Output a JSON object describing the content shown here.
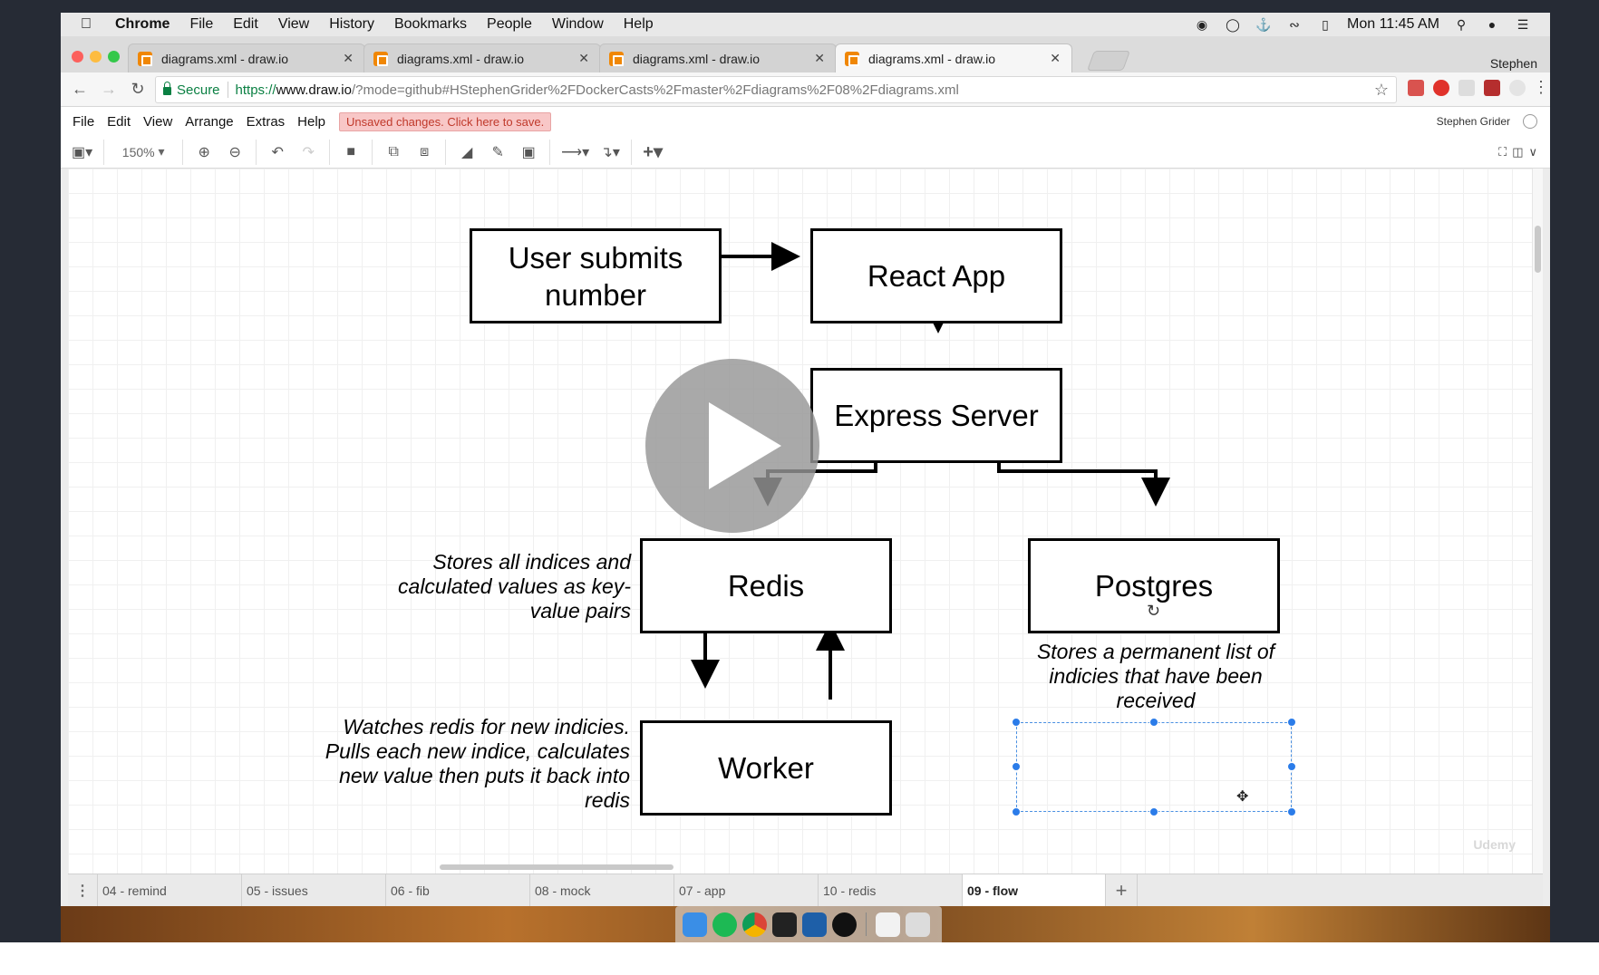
{
  "menubar": {
    "app": "Chrome",
    "items": [
      "File",
      "Edit",
      "View",
      "History",
      "Bookmarks",
      "People",
      "Window",
      "Help"
    ],
    "clock": "Mon 11:45 AM"
  },
  "tabs": [
    {
      "title": "diagrams.xml - draw.io"
    },
    {
      "title": "diagrams.xml - draw.io"
    },
    {
      "title": "diagrams.xml - draw.io"
    },
    {
      "title": "diagrams.xml - draw.io"
    }
  ],
  "profile_name": "Stephen",
  "address": {
    "secure_label": "Secure",
    "url_scheme": "https://",
    "url_host": "www.draw.io",
    "url_rest": "/?mode=github#HStephenGrider%2FDockerCasts%2Fmaster%2Fdiagrams%2F08%2Fdiagrams.xml"
  },
  "drawio_menu": {
    "items": [
      "File",
      "Edit",
      "View",
      "Arrange",
      "Extras",
      "Help"
    ],
    "unsaved": "Unsaved changes. Click here to save.",
    "user": "Stephen Grider"
  },
  "toolbar": {
    "zoom": "150%"
  },
  "diagram": {
    "boxes": {
      "user": "User submits number",
      "react": "React App",
      "express": "Express Server",
      "redis": "Redis",
      "postgres": "Postgres",
      "worker": "Worker"
    },
    "notes": {
      "redis": "Stores all indices and calculated values as key-value pairs",
      "worker": "Watches redis for new indicies. Pulls each new indice, calculates new value then puts it back into redis",
      "postgres": "Stores a permanent list of indicies that have been received"
    }
  },
  "page_tabs": [
    {
      "label": "04 - remind"
    },
    {
      "label": "05 - issues"
    },
    {
      "label": "06 - fib"
    },
    {
      "label": "08 - mock"
    },
    {
      "label": "07 - app"
    },
    {
      "label": "10 - redis"
    },
    {
      "label": "09 - flow",
      "active": true
    }
  ],
  "watermark": "Udemy",
  "colors": {
    "drawio_orange": "#f08705",
    "selection_blue": "#2b7ce9",
    "unsaved_bg": "#f8c7c7",
    "secure_green": "#0b8043"
  }
}
